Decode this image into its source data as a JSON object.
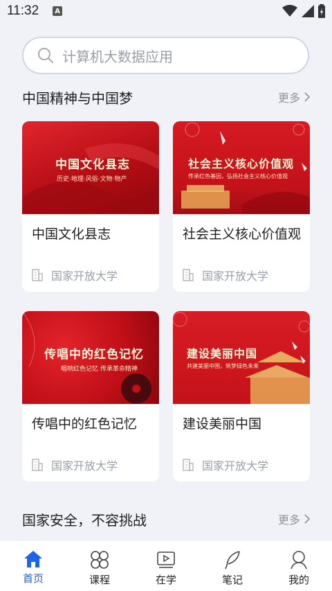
{
  "status_bar": {
    "time": "11:32",
    "indicator": "A"
  },
  "search": {
    "placeholder": "计算机大数据应用"
  },
  "sections": [
    {
      "title": "中国精神与中国梦",
      "more": "更多"
    },
    {
      "title": "国家安全，不容挑战",
      "more": "更多"
    }
  ],
  "cards": [
    {
      "banner_title": "中国文化县志",
      "banner_sub": "历史·地理·风俗·文物·物产",
      "title": "中国文化县志",
      "school": "国家开放大学"
    },
    {
      "banner_title": "社会主义核心价值观",
      "banner_sub": "传承红色基因，弘扬社会主义核心价值观",
      "title": "社会主义核心价值观",
      "school": "国家开放大学"
    },
    {
      "banner_title": "传唱中的红色记忆",
      "banner_sub": "唱响红色记忆  传承革命精神",
      "title": "传唱中的红色记忆",
      "school": "国家开放大学"
    },
    {
      "banner_title": "建设美丽中国",
      "banner_sub": "共建美丽中国，筑梦绿色未来",
      "title": "建设美丽中国",
      "school": "国家开放大学"
    }
  ],
  "tabs": [
    {
      "label": "首页",
      "icon": "home-icon",
      "active": true
    },
    {
      "label": "课程",
      "icon": "grid-flower-icon",
      "active": false
    },
    {
      "label": "在学",
      "icon": "video-icon",
      "active": false
    },
    {
      "label": "笔记",
      "icon": "feather-icon",
      "active": false
    },
    {
      "label": "我的",
      "icon": "user-icon",
      "active": false
    }
  ],
  "colors": {
    "accent": "#1f63e6",
    "banner_red": "#c4121b",
    "background": "#f1f2f7"
  }
}
